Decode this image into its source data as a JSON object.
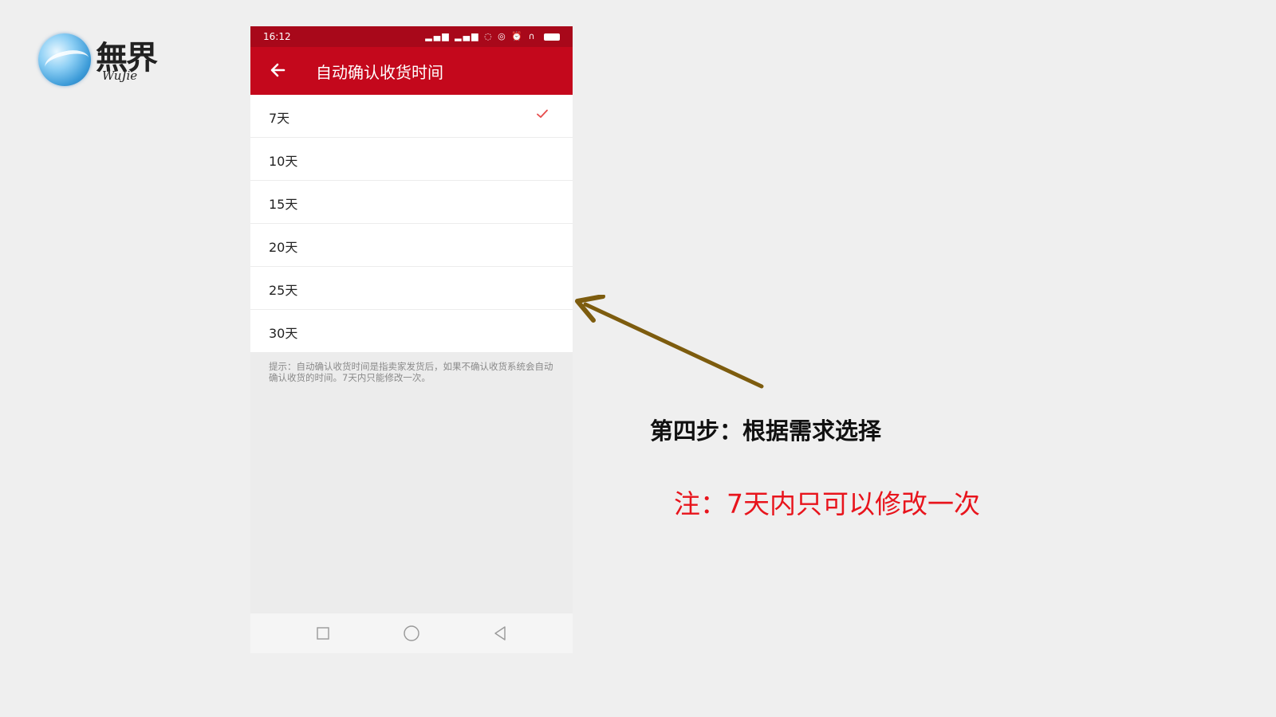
{
  "logo": {
    "text": "無界",
    "sub": "WuJie"
  },
  "status_bar": {
    "time": "16:12",
    "signal": "▂▄▆ ▂▄▆",
    "extra_icons": "◌ ◎ ⏰ ∩"
  },
  "app_bar": {
    "title": "自动确认收货时间"
  },
  "options": [
    {
      "label": "7天",
      "selected": true
    },
    {
      "label": "10天",
      "selected": false
    },
    {
      "label": "15天",
      "selected": false
    },
    {
      "label": "20天",
      "selected": false
    },
    {
      "label": "25天",
      "selected": false
    },
    {
      "label": "30天",
      "selected": false
    }
  ],
  "hint": "提示：自动确认收货时间是指卖家发货后，如果不确认收货系统会自动确认收货的时间。7天内只能修改一次。",
  "annotation": {
    "step": "第四步：根据需求选择",
    "note": "注：7天内只可以修改一次"
  },
  "colors": {
    "status_bar": "#a8081a",
    "app_bar": "#c4081c",
    "arrow": "#7d5c0e",
    "note": "#e8141c",
    "check": "#e64a4a"
  }
}
